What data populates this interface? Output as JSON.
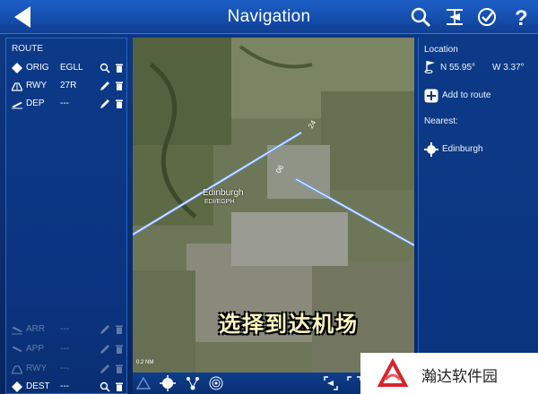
{
  "header": {
    "title": "Navigation"
  },
  "route": {
    "heading": "ROUTE",
    "rows": [
      {
        "label": "ORIG",
        "value": "EGLL"
      },
      {
        "label": "RWY",
        "value": "27R"
      },
      {
        "label": "DEP",
        "value": "---"
      },
      {
        "label": "ARR",
        "value": "---"
      },
      {
        "label": "APP",
        "value": "---"
      },
      {
        "label": "RWY",
        "value": "---"
      },
      {
        "label": "DEST",
        "value": "---"
      }
    ]
  },
  "map": {
    "airport_name": "Edinburgh",
    "airport_code": "EDI/EGPH",
    "runway_end_a": "24",
    "runway_end_b": "06",
    "scale": "0.2 NM",
    "caption": "选择到达机场"
  },
  "location": {
    "heading": "Location",
    "lat": "N 55.95°",
    "lon": "W 3.37°",
    "add_label": "Add to route",
    "nearest_heading": "Nearest:",
    "nearest_item": "Edinburgh"
  },
  "watermark": {
    "text": "瀚达软件园"
  },
  "colors": {
    "accent": "#1550b0",
    "panel": "#0b3480",
    "runway": "#6fa0ff"
  }
}
